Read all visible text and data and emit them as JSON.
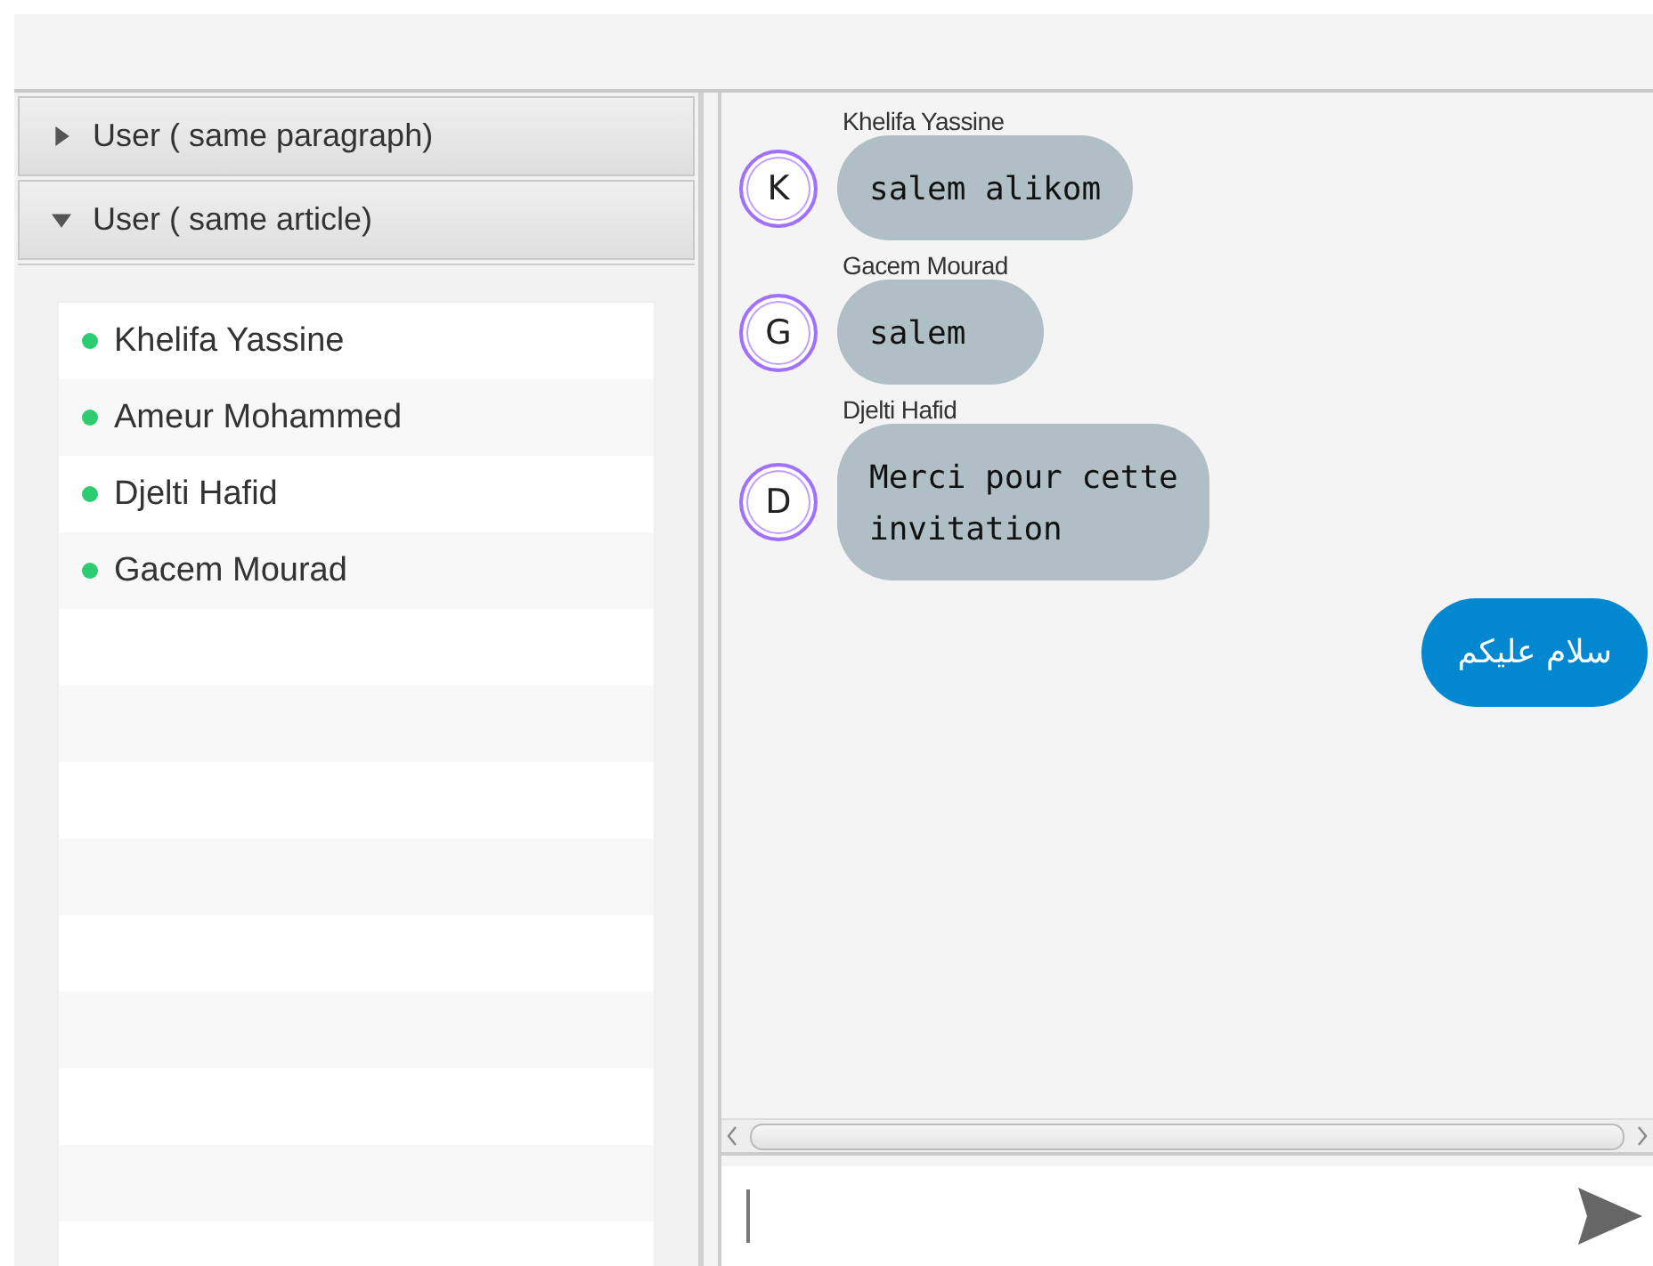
{
  "sections": [
    {
      "title": "User ( same paragraph)",
      "expanded": false
    },
    {
      "title": "User ( same article)",
      "expanded": true,
      "users": [
        {
          "name": "Khelifa Yassine",
          "color": "#2ecc71"
        },
        {
          "name": "Ameur Mohammed",
          "color": "#2ecc71"
        },
        {
          "name": "Djelti Hafid",
          "color": "#2ecc71"
        },
        {
          "name": "Gacem Mourad",
          "color": "#2ecc71"
        }
      ]
    }
  ],
  "messages": [
    {
      "kind": "incoming",
      "sender": "Khelifa Yassine",
      "avatar": "K",
      "text": "salem alikom"
    },
    {
      "kind": "incoming",
      "sender": "Gacem Mourad",
      "avatar": "G",
      "text": "salem"
    },
    {
      "kind": "incoming",
      "sender": "Djelti Hafid",
      "avatar": "D",
      "text": "Merci pour cette\ninvitation"
    },
    {
      "kind": "outgoing",
      "text": "سلام عليكم"
    }
  ],
  "composer": {
    "focused": true
  }
}
